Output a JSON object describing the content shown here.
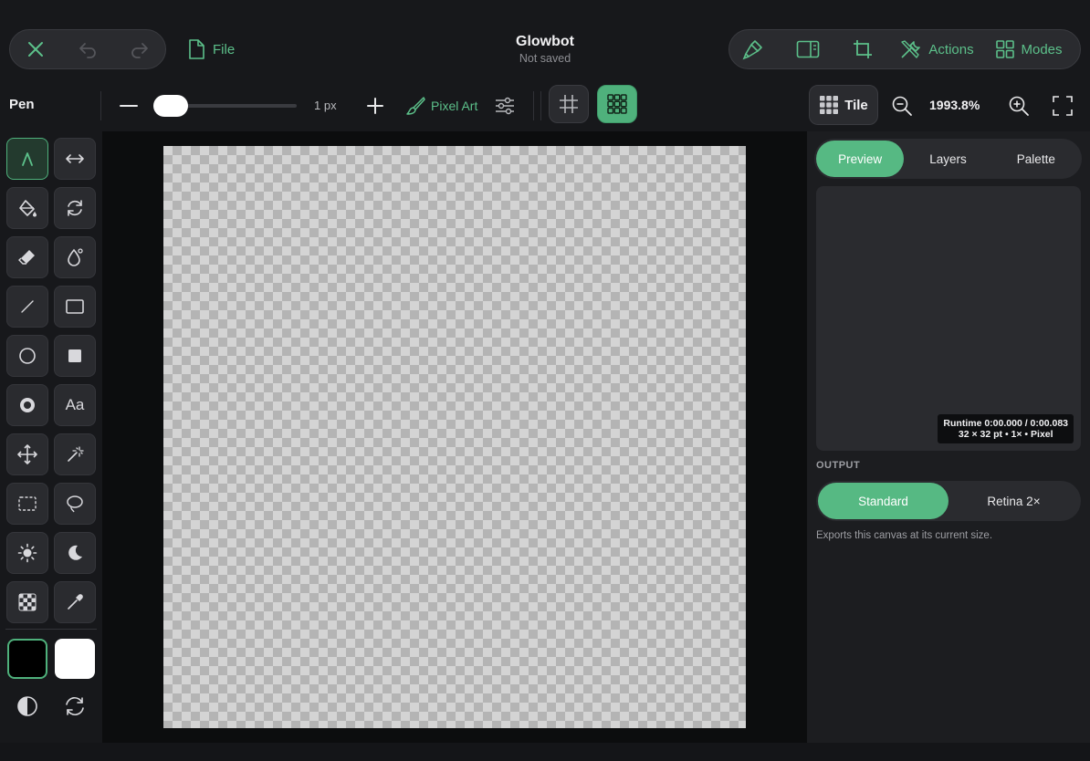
{
  "colors": {
    "accent": "#4fb17c",
    "accent_text": "#5cc08a",
    "background": "#17181b",
    "canvas_light": "#d4d4d4",
    "canvas_dark": "#b4b4b4",
    "primary_color": "#000000",
    "secondary_color": "#ffffff"
  },
  "header": {
    "file_label": "File",
    "title": "Glowbot",
    "subtitle": "Not saved",
    "actions_label": "Actions",
    "modes_label": "Modes"
  },
  "options": {
    "tool_name": "Pen",
    "size_label": "1 px",
    "pixel_art_label": "Pixel Art",
    "tile_label": "Tile",
    "zoom_label": "1993.8%"
  },
  "tools": [
    {
      "name": "pen-tool",
      "icon": "pen-nib-icon",
      "active": true
    },
    {
      "name": "symmetry-tool",
      "icon": "horizontal-arrows-icon"
    },
    {
      "name": "fill-tool",
      "icon": "paint-bucket-icon"
    },
    {
      "name": "rotate-tool",
      "icon": "rotate-icon"
    },
    {
      "name": "eraser-tool",
      "icon": "eraser-icon"
    },
    {
      "name": "blur-tool",
      "icon": "droplet-icon"
    },
    {
      "name": "line-tool",
      "icon": "line-icon"
    },
    {
      "name": "rectangle-tool",
      "icon": "rectangle-outline-icon"
    },
    {
      "name": "ellipse-tool",
      "icon": "circle-outline-icon"
    },
    {
      "name": "filled-rectangle-tool",
      "icon": "filled-square-icon"
    },
    {
      "name": "ring-tool",
      "icon": "ring-icon"
    },
    {
      "name": "text-tool",
      "icon": "text-icon",
      "text": "Aa"
    },
    {
      "name": "move-tool",
      "icon": "move-arrows-icon"
    },
    {
      "name": "magic-wand-tool",
      "icon": "magic-wand-icon"
    },
    {
      "name": "rect-select-tool",
      "icon": "dashed-rect-select-icon"
    },
    {
      "name": "lasso-tool",
      "icon": "lasso-icon"
    },
    {
      "name": "brighten-tool",
      "icon": "sun-icon"
    },
    {
      "name": "darken-tool",
      "icon": "moon-icon"
    },
    {
      "name": "dither-tool",
      "icon": "checker-pattern-icon"
    },
    {
      "name": "eyedropper-tool",
      "icon": "eyedropper-icon"
    }
  ],
  "panel": {
    "tabs": [
      "Preview",
      "Layers",
      "Palette"
    ],
    "active_tab": "Preview",
    "runtime_line1": "Runtime 0:00.000 / 0:00.083",
    "runtime_line2": "32 × 32 pt • 1× • Pixel",
    "output_label": "OUTPUT",
    "output_options": [
      "Standard",
      "Retina 2×"
    ],
    "active_output": "Standard",
    "export_note": "Exports this canvas at its current size."
  }
}
